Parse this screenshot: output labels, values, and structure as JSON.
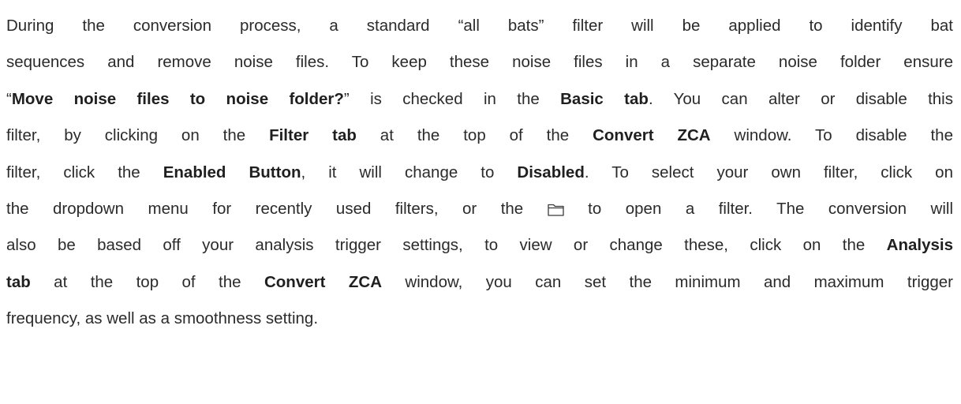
{
  "paragraph": {
    "l1": {
      "t1": "During the conversion process, a standard “all bats” filter will be applied to identify bat"
    },
    "l2": {
      "t1": "sequences and remove noise files. To keep these noise files in a separate noise folder ensure"
    },
    "l3": {
      "t1": "“",
      "b1": "Move noise files to noise folder?",
      "t2": "” is checked in the ",
      "b2": "Basic tab",
      "t3": ". You can alter or disable this"
    },
    "l4": {
      "t1": "filter, by clicking on the ",
      "b1": "Filter tab",
      "t2": " at the top of the ",
      "b2": "Convert ZCA",
      "t3": " window. To disable the"
    },
    "l5": {
      "t1": "filter, click the ",
      "b1": "Enabled Button",
      "t2": ", it will change to ",
      "b2": "Disabled",
      "t3": ". To select your own filter, click on"
    },
    "l6": {
      "t1": "the dropdown menu for recently used filters, or the ",
      "icon": "folder-icon",
      "t2": " to open a filter. The conversion will"
    },
    "l7": {
      "t1": "also be based off your analysis trigger settings, to view or change these, click on the ",
      "b1": "Analysis"
    },
    "l8": {
      "b1": "tab",
      "t1": " at the top of the ",
      "b2": "Convert ZCA",
      "t2": " window, you can set the minimum and maximum trigger"
    },
    "l9": {
      "t1": "frequency, as well as a smoothness setting."
    }
  }
}
